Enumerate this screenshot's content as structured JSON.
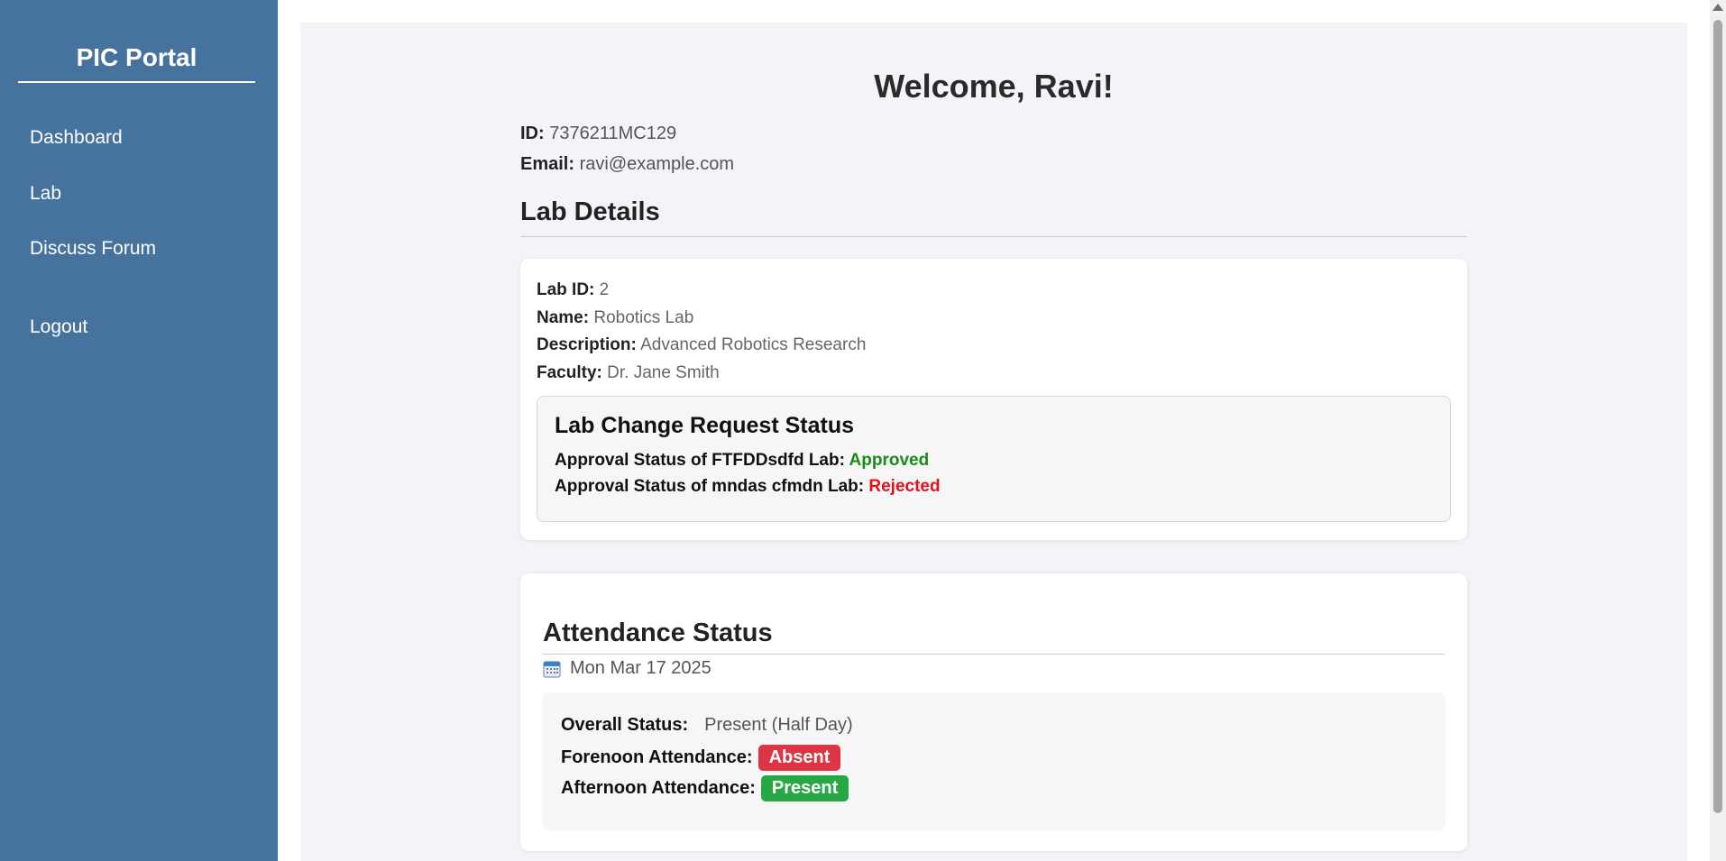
{
  "sidebar": {
    "brand": "PIC Portal",
    "items": [
      {
        "label": "Dashboard"
      },
      {
        "label": "Lab"
      },
      {
        "label": "Discuss Forum"
      },
      {
        "label": "Logout"
      }
    ]
  },
  "header": {
    "welcome": "Welcome, Ravi!",
    "id_label": "ID:",
    "id_value": "7376211MC129",
    "email_label": "Email:",
    "email_value": "ravi@example.com"
  },
  "lab_details": {
    "title": "Lab Details",
    "rows": [
      {
        "label": "Lab ID:",
        "value": "2"
      },
      {
        "label": "Name:",
        "value": "Robotics Lab"
      },
      {
        "label": "Description:",
        "value": "Advanced Robotics Research"
      },
      {
        "label": "Faculty:",
        "value": "Dr. Jane Smith"
      }
    ],
    "change_request": {
      "title": "Lab Change Request Status",
      "requests": [
        {
          "label": "Approval Status of FTFDDsdfd Lab:",
          "status": "Approved",
          "color": "#1a8a1a"
        },
        {
          "label": "Approval Status of mndas cfmdn Lab:",
          "status": "Rejected",
          "color": "#e0121b"
        }
      ]
    }
  },
  "attendance": {
    "title": "Attendance Status",
    "date": "Mon Mar 17 2025",
    "overall_label": "Overall Status:",
    "overall_value": "Present (Half Day)",
    "forenoon_label": "Forenoon Attendance:",
    "forenoon_value": "Absent",
    "forenoon_color": "#dc3545",
    "afternoon_label": "Afternoon Attendance:",
    "afternoon_value": "Present",
    "afternoon_color": "#28a745"
  }
}
